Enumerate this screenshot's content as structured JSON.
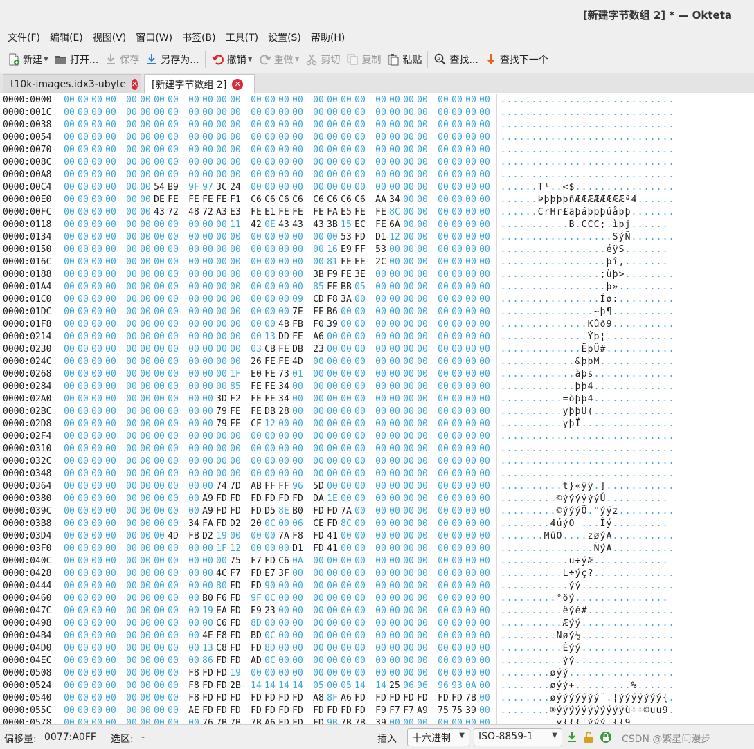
{
  "window": {
    "title": "[新建字节数组 2] * — Okteta"
  },
  "menu": [
    {
      "label": "文件(F)"
    },
    {
      "label": "编辑(E)"
    },
    {
      "label": "视图(V)"
    },
    {
      "label": "窗口(W)"
    },
    {
      "label": "书签(B)"
    },
    {
      "label": "工具(T)"
    },
    {
      "label": "设置(S)"
    },
    {
      "label": "帮助(H)"
    }
  ],
  "toolbar": {
    "new": "新建",
    "open": "打开...",
    "save": "保存",
    "save_as": "另存为...",
    "undo": "撤销",
    "redo": "重做",
    "cut": "剪切",
    "copy": "复制",
    "paste": "粘贴",
    "find": "查找...",
    "find_next": "查找下一个"
  },
  "tabs": [
    {
      "label": "t10k-images.idx3-ubyte",
      "active": false
    },
    {
      "label": "[新建字节数组 2]",
      "active": true
    }
  ],
  "hex_rows": [
    {
      "addr": "0000:0000",
      "bytes": "00 00 00 00 00 00 00 00 00 00 00 00 00 00 00 00 00 00 00 00 00 00 00 00 00 00 00 00",
      "ascii": "............................"
    },
    {
      "addr": "0000:001C",
      "bytes": "00 00 00 00 00 00 00 00 00 00 00 00 00 00 00 00 00 00 00 00 00 00 00 00 00 00 00 00",
      "ascii": "............................"
    },
    {
      "addr": "0000:0038",
      "bytes": "00 00 00 00 00 00 00 00 00 00 00 00 00 00 00 00 00 00 00 00 00 00 00 00 00 00 00 00",
      "ascii": "............................"
    },
    {
      "addr": "0000:0054",
      "bytes": "00 00 00 00 00 00 00 00 00 00 00 00 00 00 00 00 00 00 00 00 00 00 00 00 00 00 00 00",
      "ascii": "............................"
    },
    {
      "addr": "0000:0070",
      "bytes": "00 00 00 00 00 00 00 00 00 00 00 00 00 00 00 00 00 00 00 00 00 00 00 00 00 00 00 00",
      "ascii": "............................"
    },
    {
      "addr": "0000:008C",
      "bytes": "00 00 00 00 00 00 00 00 00 00 00 00 00 00 00 00 00 00 00 00 00 00 00 00 00 00 00 00",
      "ascii": "............................"
    },
    {
      "addr": "0000:00A8",
      "bytes": "00 00 00 00 00 00 00 00 00 00 00 00 00 00 00 00 00 00 00 00 00 00 00 00 00 00 00 00",
      "ascii": "............................"
    },
    {
      "addr": "0000:00C4",
      "bytes": "00 00 00 00 00 00 54 B9 9F 97 3C 24 00 00 00 00 00 00 00 00 00 00 00 00 00 00 00 00",
      "ascii": "......T¹..<$................"
    },
    {
      "addr": "0000:00E0",
      "bytes": "00 00 00 00 00 00 DE FE FE FE FE F1 C6 C6 C6 C6 C6 C6 C6 C6 AA 34 00 00 00 00 00 00",
      "ascii": "......ÞþþþþñÆÆÆÆÆÆÆÆª4......"
    },
    {
      "addr": "0000:00FC",
      "bytes": "00 00 00 00 00 00 43 72 48 72 A3 E3 FE E1 FE FE FE FA E5 FE FE 8C 00 00 00 00 00 00",
      "ascii": "......CrHr£ãþáþþþúåþþ......."
    },
    {
      "addr": "0000:0118",
      "bytes": "00 00 00 00 00 00 00 00 00 00 00 11 42 0E 43 43 43 3B 15 EC FE 6A 00 00 00 00 00 00",
      "ascii": "...........B.CCC;.ìþj......"
    },
    {
      "addr": "0000:0134",
      "bytes": "00 00 00 00 00 00 00 00 00 00 00 00 00 00 00 00 00 00 53 FD D1 12 00 00 00 00 00 00",
      "ascii": "..................SýÑ......."
    },
    {
      "addr": "0000:0150",
      "bytes": "00 00 00 00 00 00 00 00 00 00 00 00 00 00 00 00 00 16 E9 FF 53 00 00 00 00 00 00 00",
      "ascii": ".................éÿS......."
    },
    {
      "addr": "0000:016C",
      "bytes": "00 00 00 00 00 00 00 00 00 00 00 00 00 00 00 00 00 81 FE EE 2C 00 00 00 00 00 00 00",
      "ascii": ".................þî,......."
    },
    {
      "addr": "0000:0188",
      "bytes": "00 00 00 00 00 00 00 00 00 00 00 00 00 00 00 00 3B F9 FE 3E 00 00 00 00 00 00 00 00",
      "ascii": "................;ùþ>........"
    },
    {
      "addr": "0000:01A4",
      "bytes": "00 00 00 00 00 00 00 00 00 00 00 00 00 00 00 00 85 FE BB 05 00 00 00 00 00 00 00 00",
      "ascii": ".................þ»........."
    },
    {
      "addr": "0000:01C0",
      "bytes": "00 00 00 00 00 00 00 00 00 00 00 00 00 00 00 09 CD F8 3A 00 00 00 00 00 00 00 00 00",
      "ascii": "................Íø:........."
    },
    {
      "addr": "0000:01DC",
      "bytes": "00 00 00 00 00 00 00 00 00 00 00 00 00 00 00 7E FE B6 00 00 00 00 00 00 00 00 00 00",
      "ascii": "...............~þ¶.........."
    },
    {
      "addr": "0000:01F8",
      "bytes": "00 00 00 00 00 00 00 00 00 00 00 00 00 00 4B FB F0 39 00 00 00 00 00 00 00 00 00 00",
      "ascii": "..............Kûð9.........."
    },
    {
      "addr": "0000:0214",
      "bytes": "00 00 00 00 00 00 00 00 00 00 00 00 00 13 DD FE A6 00 00 00 00 00 00 00 00 00 00 00",
      "ascii": "..............Ýþ¦..........."
    },
    {
      "addr": "0000:0230",
      "bytes": "00 00 00 00 00 00 00 00 00 00 00 00 03 CB FE DB 23 00 00 00 00 00 00 00 00 00 00 00",
      "ascii": ".............ËþÛ#..........."
    },
    {
      "addr": "0000:024C",
      "bytes": "00 00 00 00 00 00 00 00 00 00 00 00 26 FE FE 4D 00 00 00 00 00 00 00 00 00 00 00 00",
      "ascii": "............&þþM............"
    },
    {
      "addr": "0000:0268",
      "bytes": "00 00 00 00 00 00 00 00 00 00 00 1F E0 FE 73 01 00 00 00 00 00 00 00 00 00 00 00 00",
      "ascii": "............àþs............."
    },
    {
      "addr": "0000:0284",
      "bytes": "00 00 00 00 00 00 00 00 00 00 00 85 FE FE 34 00 00 00 00 00 00 00 00 00 00 00 00 00",
      "ascii": "............þþ4............."
    },
    {
      "addr": "0000:02A0",
      "bytes": "00 00 00 00 00 00 00 00 00 00 3D F2 FE FE 34 00 00 00 00 00 00 00 00 00 00 00 00 00",
      "ascii": "..........=òþþ4............."
    },
    {
      "addr": "0000:02BC",
      "bytes": "00 00 00 00 00 00 00 00 00 00 79 FE FE DB 28 00 00 00 00 00 00 00 00 00 00 00 00 00",
      "ascii": "..........yþþÛ(............."
    },
    {
      "addr": "0000:02D8",
      "bytes": "00 00 00 00 00 00 00 00 00 00 79 FE CF 12 00 00 00 00 00 00 00 00 00 00 00 00 00 00",
      "ascii": "..........yþÏ..............."
    },
    {
      "addr": "0000:02F4",
      "bytes": "00 00 00 00 00 00 00 00 00 00 00 00 00 00 00 00 00 00 00 00 00 00 00 00 00 00 00 00",
      "ascii": "............................"
    },
    {
      "addr": "0000:0310",
      "bytes": "00 00 00 00 00 00 00 00 00 00 00 00 00 00 00 00 00 00 00 00 00 00 00 00 00 00 00 00",
      "ascii": "............................"
    },
    {
      "addr": "0000:032C",
      "bytes": "00 00 00 00 00 00 00 00 00 00 00 00 00 00 00 00 00 00 00 00 00 00 00 00 00 00 00 00",
      "ascii": "............................"
    },
    {
      "addr": "0000:0348",
      "bytes": "00 00 00 00 00 00 00 00 00 00 00 00 00 00 00 00 00 00 00 00 00 00 00 00 00 00 00 00",
      "ascii": "............................"
    },
    {
      "addr": "0000:0364",
      "bytes": "00 00 00 00 00 00 00 00 00 00 74 7D AB FF FF 96 5D 00 00 00 00 00 00 00 00 00 00 00",
      "ascii": "..........t}«ÿÿ.]..........."
    },
    {
      "addr": "0000:0380",
      "bytes": "00 00 00 00 00 00 00 00 00 A9 FD FD FD FD FD FD DA 1E 00 00 00 00 00 00 00 00 00 00",
      "ascii": ".........©ýýýýýýÚ.........."
    },
    {
      "addr": "0000:039C",
      "bytes": "00 00 00 00 00 00 00 00 00 A9 FD FD FD D5 8E B0 FD FD 7A 00 00 00 00 00 00 00 00 00",
      "ascii": ".........©ýýýÕ.°ýýz........."
    },
    {
      "addr": "0000:03B8",
      "bytes": "00 00 00 00 00 00 00 00 34 FA FD D2 20 0C 00 06 CE FD 8C 00 00 00 00 00 00 00 00 00",
      "ascii": "........4úýÒ ...Îý........."
    },
    {
      "addr": "0000:03D4",
      "bytes": "00 00 00 00 00 00 00 4D FB D2 19 00 00 00 7A F8 FD 41 00 00 00 00 00 00 00 00 00 00",
      "ascii": ".......MûÒ....zøýA.........."
    },
    {
      "addr": "0000:03F0",
      "bytes": "00 00 00 00 00 00 00 00 00 00 1F 12 00 00 00 D1 FD 41 00 00 00 00 00 00 00 00 00 00",
      "ascii": "...............ÑýA.........."
    },
    {
      "addr": "0000:040C",
      "bytes": "00 00 00 00 00 00 00 00 00 00 00 75 F7 FD C6 0A 00 00 00 00 00 00 00 00 00 00 00 00",
      "ascii": "...........u÷ýÆ............"
    },
    {
      "addr": "0000:0428",
      "bytes": "00 00 00 00 00 00 00 00 00 00 4C F7 FD E7 3F 00 00 00 00 00 00 00 00 00 00 00 00 00",
      "ascii": "..........L÷ýç?............."
    },
    {
      "addr": "0000:0444",
      "bytes": "00 00 00 00 00 00 00 00 00 00 80 FD FD 90 00 00 00 00 00 00 00 00 00 00 00 00 00 00",
      "ascii": "...........ýý..............."
    },
    {
      "addr": "0000:0460",
      "bytes": "00 00 00 00 00 00 00 00 00 B0 F6 FD 9F 0C 00 00 00 00 00 00 00 00 00 00 00 00 00 00",
      "ascii": ".........°öý..............."
    },
    {
      "addr": "0000:047C",
      "bytes": "00 00 00 00 00 00 00 00 00 19 EA FD E9 23 00 00 00 00 00 00 00 00 00 00 00 00 00 00",
      "ascii": "..........êýé#.............."
    },
    {
      "addr": "0000:0498",
      "bytes": "00 00 00 00 00 00 00 00 00 00 C6 FD 8D 00 00 00 00 00 00 00 00 00 00 00 00 00 00 00",
      "ascii": "..........Æýý..............."
    },
    {
      "addr": "0000:04B4",
      "bytes": "00 00 00 00 00 00 00 00 00 4E F8 FD BD 0C 00 00 00 00 00 00 00 00 00 00 00 00 00 00",
      "ascii": ".........Nøý½..............."
    },
    {
      "addr": "0000:04D0",
      "bytes": "00 00 00 00 00 00 00 00 00 13 C8 FD FD 8D 00 00 00 00 00 00 00 00 00 00 00 00 00 00",
      "ascii": "..........Èýý..............."
    },
    {
      "addr": "0000:04EC",
      "bytes": "00 00 00 00 00 00 00 00 00 86 FD FD AD 0C 00 00 00 00 00 00 00 00 00 00 00 00 00 00",
      "ascii": "..........ýý................"
    },
    {
      "addr": "0000:0508",
      "bytes": "00 00 00 00 00 00 00 00 F8 FD FD 19 00 00 00 00 00 00 00 00 00 00 00 00 00 00 00 00",
      "ascii": "........øýý................."
    },
    {
      "addr": "0000:0524",
      "bytes": "00 00 00 00 00 00 00 00 F8 FD FD 2B 14 14 14 14 05 00 05 14 14 25 96 96 96 93 0A 00",
      "ascii": "........øýý+.........%......"
    },
    {
      "addr": "0000:0540",
      "bytes": "00 00 00 00 00 00 00 00 F8 FD FD FD FD FD FD FD A8 8F A6 FD FD FD FD FD FD FD 7B 00",
      "ascii": "........øýýýýýýý¨.¦ýýýýýýý{."
    },
    {
      "addr": "0000:055C",
      "bytes": "00 00 00 00 00 00 00 00 AE FD FD FD FD FD FD FD FD FD FD FD F9 F7 F7 A9 75 75 39 00",
      "ascii": "........®ýýýýýýýýýýýù÷÷©uu9."
    },
    {
      "addr": "0000:0578",
      "bytes": "00 00 00 00 00 00 00 00 00 76 7B 7B 7B A6 FD FD FD 9B 7B 7B 39 00 00 00 00 00 00 00",
      "ascii": ".........v{{{¦ýýý.{{9......."
    }
  ],
  "status": {
    "offset_label": "偏移量:",
    "offset_value": "0077:A0FF",
    "selection_label": "选区:",
    "selection_value": "-",
    "insert_mode": "插入",
    "encoding_mode": "十六进制",
    "charset": "ISO-8859-1",
    "watermark": "CSDN @繁星间漫步"
  },
  "colors": {
    "zero_byte": "#3aa6dc",
    "nonzero_byte": "#1e1e1e",
    "close_tab": "#d9293a"
  }
}
